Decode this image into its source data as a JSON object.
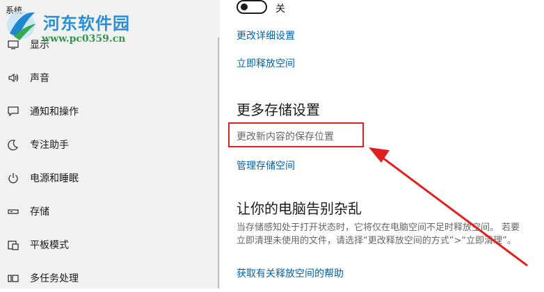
{
  "sidebar": {
    "header": "系统",
    "items": [
      {
        "label": "显示",
        "icon": "display-icon"
      },
      {
        "label": "声音",
        "icon": "sound-icon"
      },
      {
        "label": "通知和操作",
        "icon": "notification-icon"
      },
      {
        "label": "专注助手",
        "icon": "moon-icon"
      },
      {
        "label": "电源和睡眠",
        "icon": "power-icon"
      },
      {
        "label": "存储",
        "icon": "storage-icon"
      },
      {
        "label": "平板模式",
        "icon": "tablet-icon"
      },
      {
        "label": "多任务处理",
        "icon": "multitask-icon"
      }
    ]
  },
  "watermark": {
    "title": "河东软件园",
    "url": "www.pc0359.cn"
  },
  "main": {
    "toggle_label": "关",
    "toggle_state": "off",
    "change_details_link": "更改详细设置",
    "free_space_link": "立即释放空间",
    "more_storage_title": "更多存储设置",
    "change_save_location": "更改新内容的保存位置",
    "manage_spaces_link": "管理存储空间",
    "declutter_title": "让你的电脑告别杂乱",
    "declutter_desc": "当存储感知处于打开状态时，它将仅在电脑空间不足时释放空间。 若要立即清理未使用的文件，请选择“更改释放空间的方式”>“立即清理”。",
    "help_link": "获取有关释放空间的帮助"
  },
  "colors": {
    "accent": "#0063b1",
    "highlight": "#e02020",
    "sidebar_bg": "#f2f2f2"
  }
}
